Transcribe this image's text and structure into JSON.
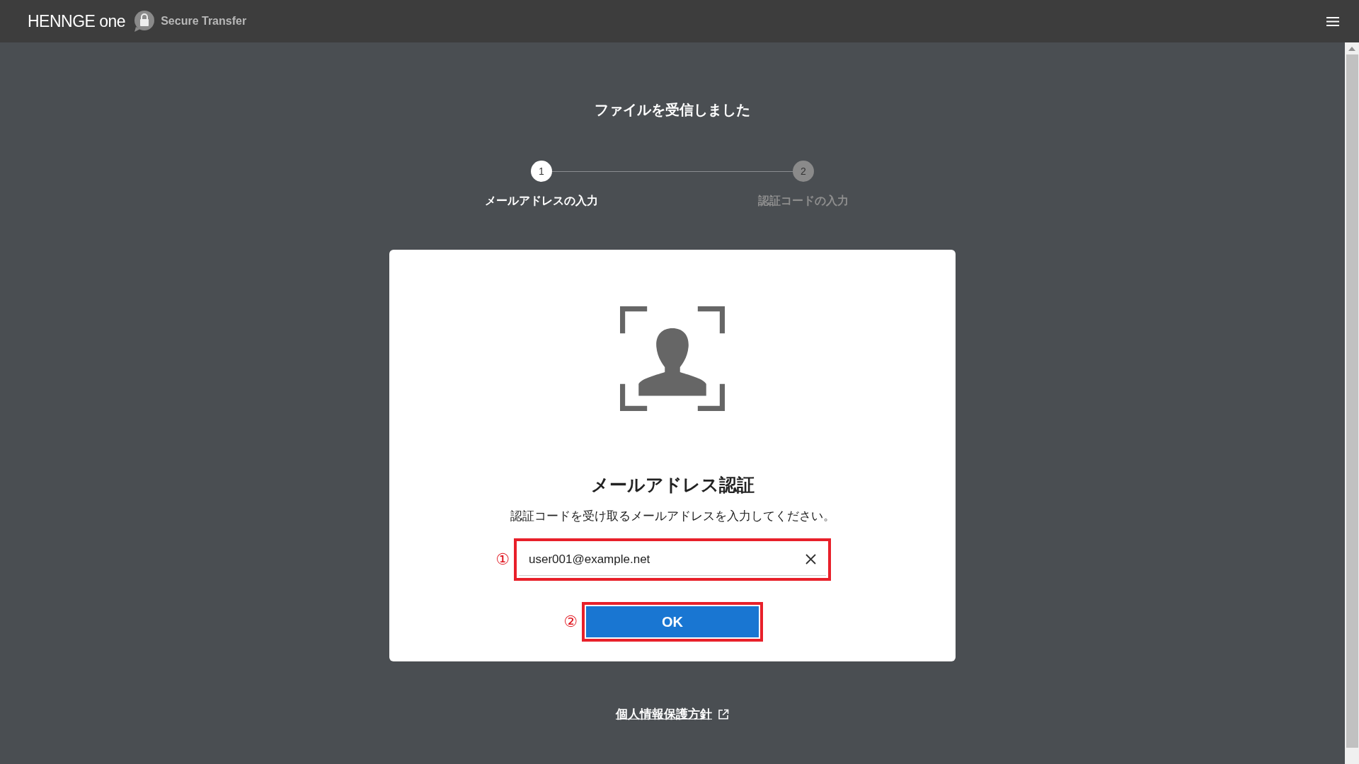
{
  "header": {
    "brand": "HENNGE one",
    "product": "Secure Transfer"
  },
  "page_title": "ファイルを受信しました",
  "steps": [
    {
      "number": "1",
      "label": "メールアドレスの入力",
      "selected": true
    },
    {
      "number": "2",
      "label": "認証コードの入力",
      "selected": false
    }
  ],
  "card": {
    "heading": "メールアドレス認証",
    "description": "認証コードを受け取るメールアドレスを入力してください。",
    "email_field": {
      "value": "user001@example.net",
      "marker": "①"
    },
    "ok_button": {
      "label": "OK",
      "marker": "②"
    }
  },
  "footer_link": "個人情報保護方針"
}
